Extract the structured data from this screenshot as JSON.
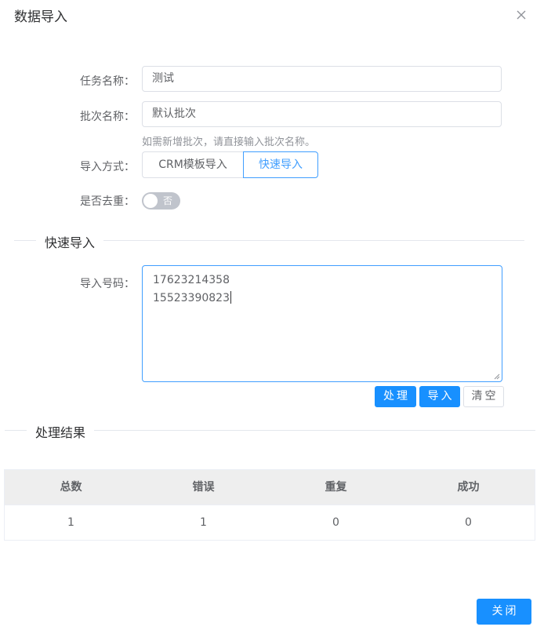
{
  "dialog": {
    "title": "数据导入"
  },
  "form": {
    "task_name": {
      "label": "任务名称：",
      "value": "测试"
    },
    "batch_name": {
      "label": "批次名称：",
      "value": "默认批次",
      "hint": "如需新增批次，请直接输入批次名称。"
    },
    "import_mode": {
      "label": "导入方式：",
      "options": [
        "CRM模板导入",
        "快速导入"
      ],
      "selected": "快速导入"
    },
    "dedupe": {
      "label": "是否去重：",
      "state_text": "否",
      "on": false
    }
  },
  "quick_import": {
    "section_title": "快速导入",
    "numbers_label": "导入号码：",
    "numbers": [
      "17623214358",
      "15523390823"
    ],
    "buttons": {
      "process": "处理",
      "import": "导入",
      "clear": "清空"
    }
  },
  "results": {
    "section_title": "处理结果",
    "columns": [
      "总数",
      "错误",
      "重复",
      "成功"
    ],
    "row": [
      "1",
      "1",
      "0",
      "0"
    ]
  },
  "footer": {
    "close_label": "关闭"
  },
  "colors": {
    "primary": "#1890ff",
    "accent_border": "#409eff",
    "switch_off": "#c0c4cc"
  }
}
